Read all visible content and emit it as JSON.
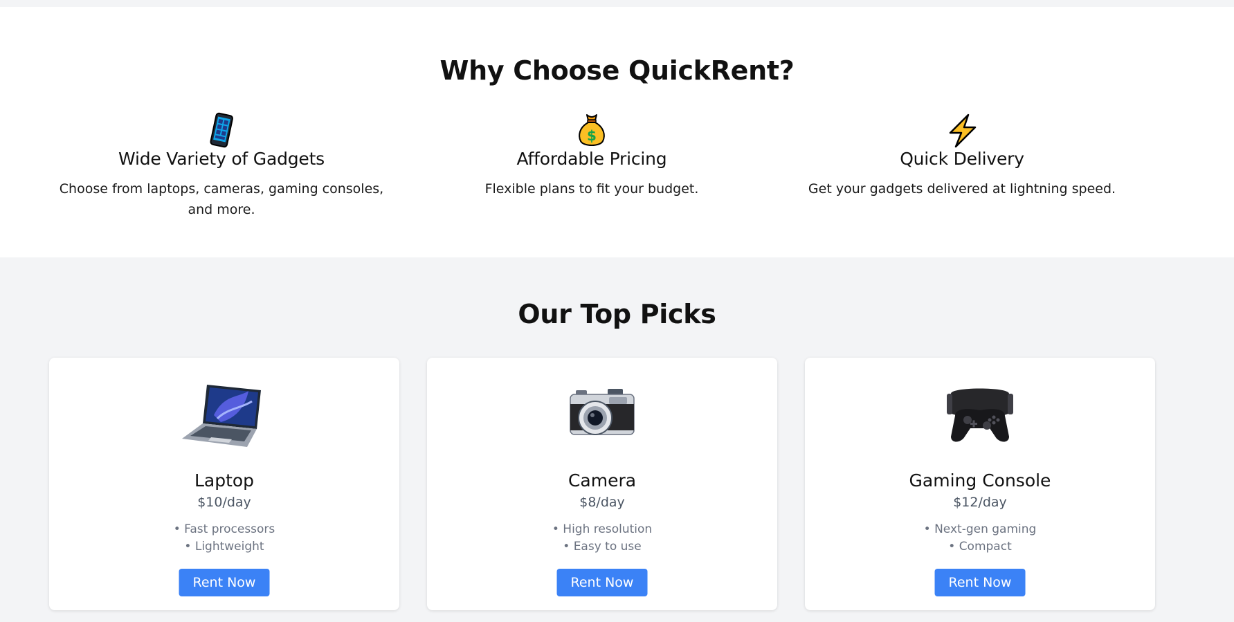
{
  "why": {
    "title": "Why Choose QuickRent?",
    "features": [
      {
        "icon": "mobile-phone-icon",
        "title": "Wide Variety of Gadgets",
        "text": "Choose from laptops, cameras, gaming consoles, and more."
      },
      {
        "icon": "money-bag-icon",
        "title": "Affordable Pricing",
        "text": "Flexible plans to fit your budget."
      },
      {
        "icon": "lightning-icon",
        "title": "Quick Delivery",
        "text": "Get your gadgets delivered at lightning speed."
      }
    ]
  },
  "picks": {
    "title": "Our Top Picks",
    "products": [
      {
        "image": "laptop-image",
        "name": "Laptop",
        "price": "$10/day",
        "features": [
          "Fast processors",
          "Lightweight"
        ],
        "cta": "Rent Now"
      },
      {
        "image": "camera-image",
        "name": "Camera",
        "price": "$8/day",
        "features": [
          "High resolution",
          "Easy to use"
        ],
        "cta": "Rent Now"
      },
      {
        "image": "gaming-console-image",
        "name": "Gaming Console",
        "price": "$12/day",
        "features": [
          "Next-gen gaming",
          "Compact"
        ],
        "cta": "Rent Now"
      }
    ]
  },
  "colors": {
    "accent": "#3b82f6",
    "page_bg": "#f3f4f6",
    "section_bg": "#ffffff"
  }
}
